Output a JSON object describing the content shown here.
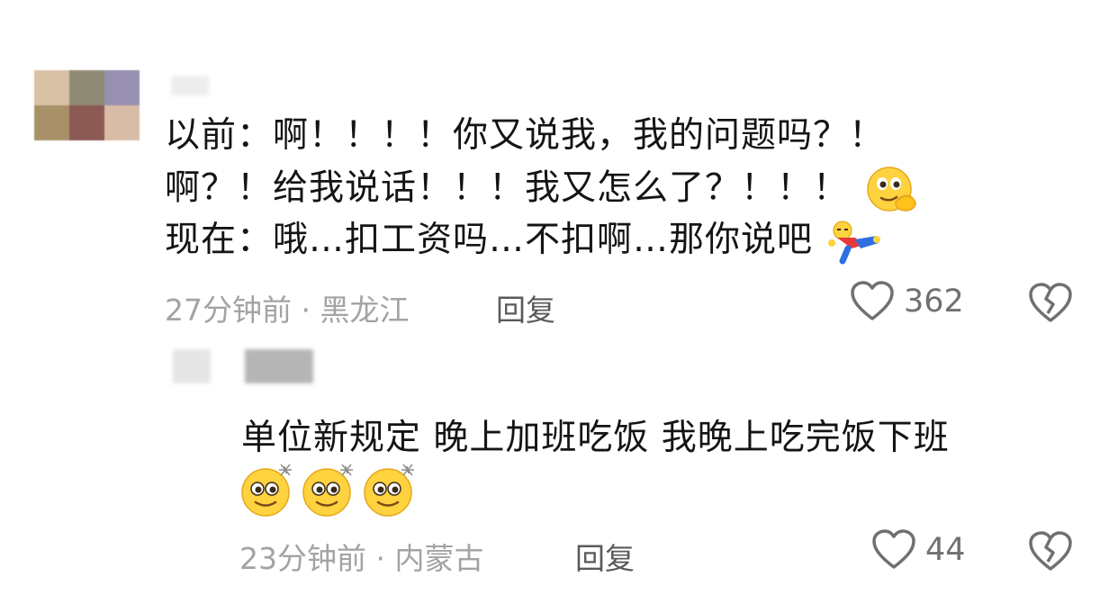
{
  "comment1": {
    "lines": [
      "以前：啊！！！！你又说我，我的问题吗？！",
      "啊？！给我说话！！！我又怎么了？！！！",
      "现在：哦…扣工资吗…不扣啊…那你说吧"
    ],
    "time": "27分钟前",
    "separator": "·",
    "location": "黑龙江",
    "reply_label": "回复",
    "likes": "362"
  },
  "reply1": {
    "lines": [
      "单位新规定 晚上加班吃饭 我晚上吃完饭下班"
    ],
    "time": "23分钟前",
    "separator": "·",
    "location": "内蒙古",
    "reply_label": "回复",
    "likes": "44"
  },
  "icons": {
    "like": "heart-outline-icon",
    "dislike": "broken-heart-icon",
    "emoji_thinking": "thinking-face-emoji",
    "emoji_lying": "lying-down-figure-emoji",
    "emoji_dazzled": "dazzled-face-emoji"
  },
  "colors": {
    "text": "#141414",
    "meta": "#a3a3a3",
    "reply": "#5a5a5a",
    "icon": "#707070"
  }
}
